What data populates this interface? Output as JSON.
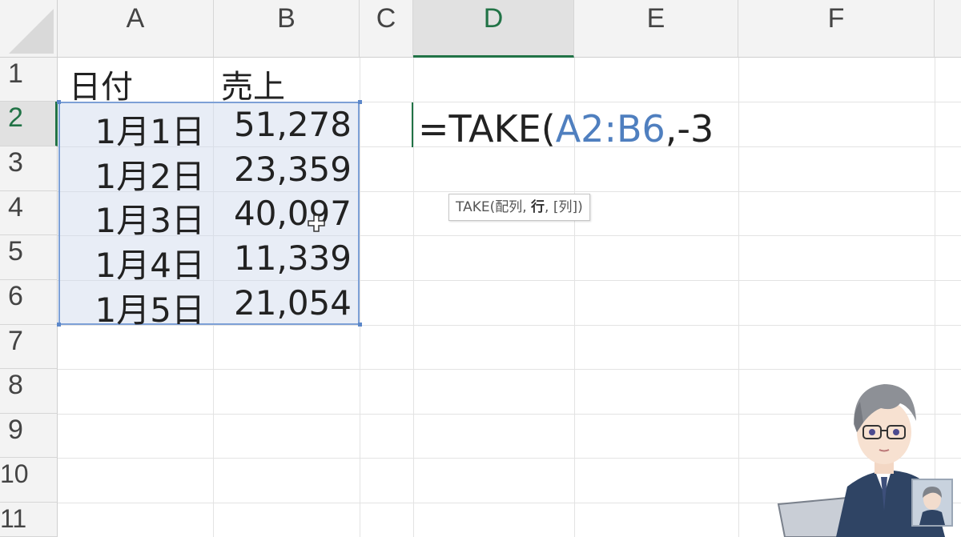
{
  "columns": [
    "A",
    "B",
    "C",
    "D",
    "E",
    "F"
  ],
  "active_column": "D",
  "rows": [
    "1",
    "2",
    "3",
    "4",
    "5",
    "6",
    "7",
    "8",
    "9",
    "10",
    "11"
  ],
  "active_row": "2",
  "headers": {
    "date": "日付",
    "sales": "売上"
  },
  "data_rows": [
    {
      "date": "1月1日",
      "sales": "51,278"
    },
    {
      "date": "1月2日",
      "sales": "23,359"
    },
    {
      "date": "1月3日",
      "sales": "40,097"
    },
    {
      "date": "1月4日",
      "sales": "11,339"
    },
    {
      "date": "1月5日",
      "sales": "21,054"
    }
  ],
  "formula": {
    "prefix": "=TAKE(",
    "range": "A2:B6",
    "suffix": ",-3"
  },
  "tooltip": {
    "func": "TAKE(",
    "arg1": "配列",
    "sep1": ", ",
    "arg2": "行",
    "sep2": ", ",
    "arg3": "[列]",
    "close": ")"
  },
  "colors": {
    "accent": "#217346",
    "range_ref": "#4f7fbf",
    "selection": "#7da0d6"
  },
  "icons": {
    "cursor": "plus-cursor-icon",
    "avatar": "presenter-avatar"
  }
}
